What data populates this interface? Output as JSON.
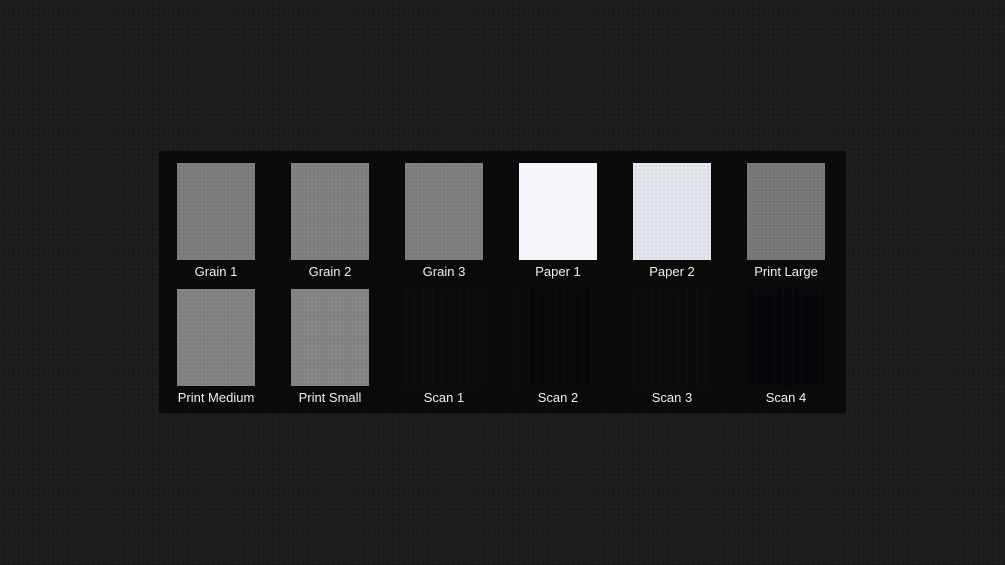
{
  "presets": [
    {
      "label": "Grain 1",
      "color": "#7b7b7b",
      "texture": "noise"
    },
    {
      "label": "Grain 2",
      "color": "#7e7e7e",
      "texture": "noise"
    },
    {
      "label": "Grain 3",
      "color": "#7d7d7d",
      "texture": "noise"
    },
    {
      "label": "Paper 1",
      "color": "#f7f6fd",
      "texture": "flat"
    },
    {
      "label": "Paper 2",
      "color": "#e4e6ee",
      "texture": "noise"
    },
    {
      "label": "Print Large",
      "color": "#767676",
      "texture": "noise"
    },
    {
      "label": "Print Medium",
      "color": "#818182",
      "texture": "noise"
    },
    {
      "label": "Print Small",
      "color": "#838385",
      "texture": "noise"
    },
    {
      "label": "Scan 1",
      "color": "#0b0b0c",
      "texture": "scan"
    },
    {
      "label": "Scan 2",
      "color": "#08090b",
      "texture": "scan"
    },
    {
      "label": "Scan 3",
      "color": "#080a0b",
      "texture": "scan"
    },
    {
      "label": "Scan 4",
      "color": "#05070a",
      "texture": "scan"
    }
  ]
}
